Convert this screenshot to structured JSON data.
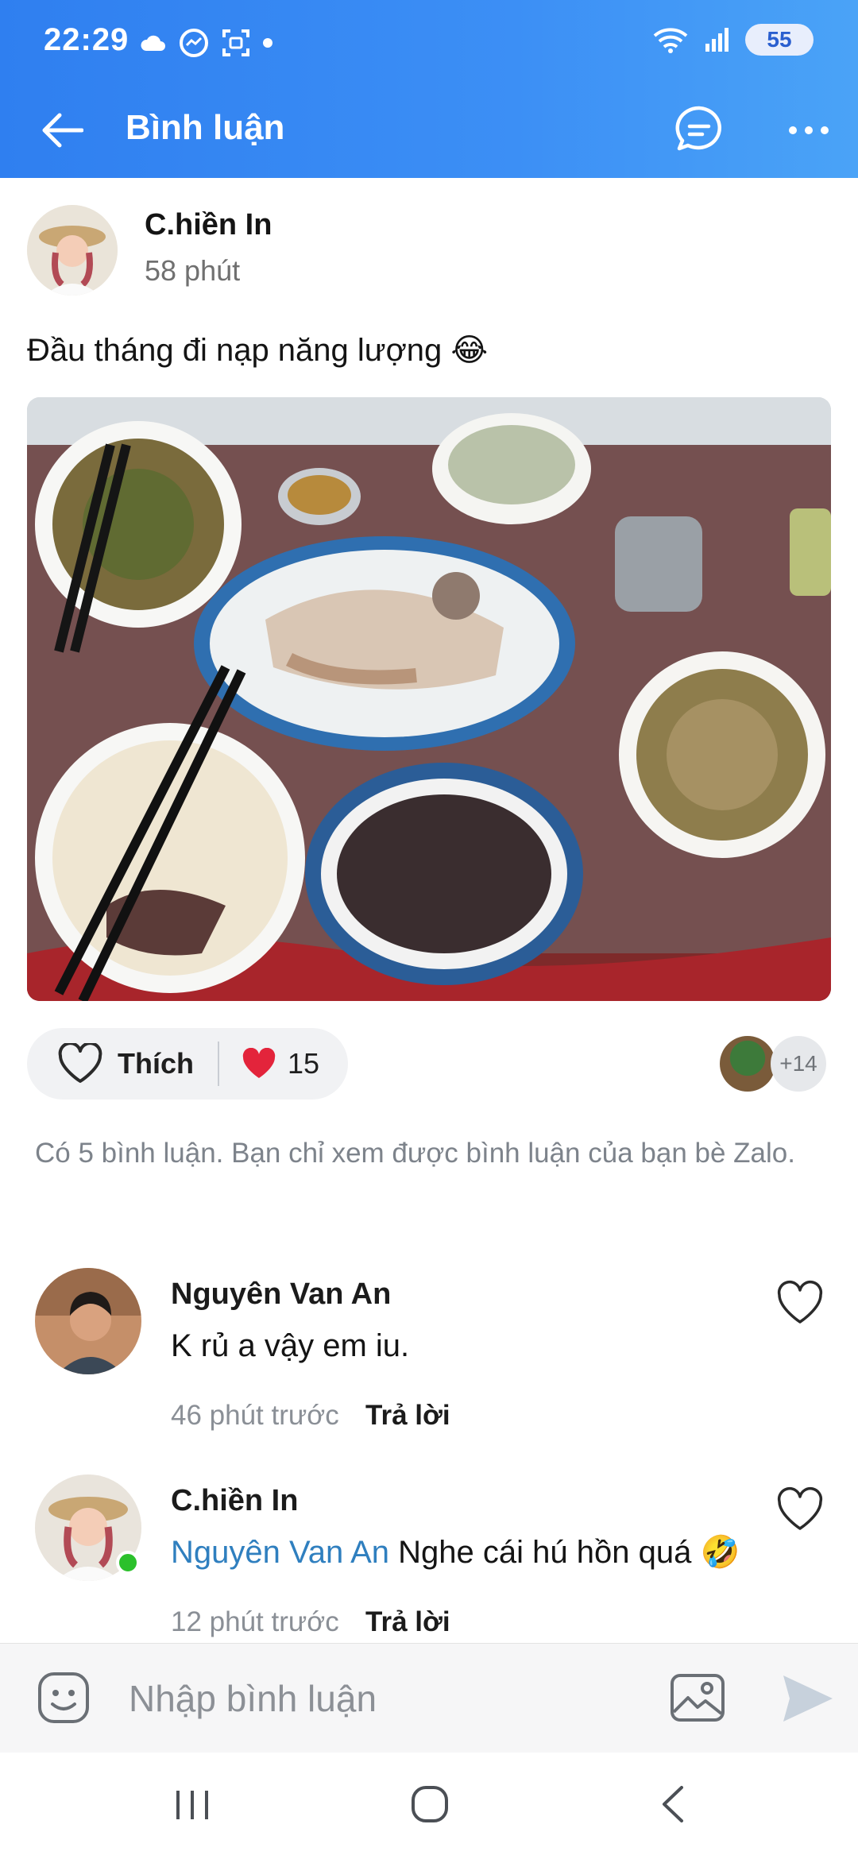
{
  "status_bar": {
    "time": "22:29",
    "battery": "55",
    "icons_left": [
      "cloud-icon",
      "messenger-icon",
      "screenshot-icon",
      "dot-icon"
    ],
    "icons_right": [
      "wifi-icon",
      "signal-icon"
    ]
  },
  "app_bar": {
    "title": "Bình luận",
    "icons": [
      "back-arrow-icon",
      "chat-bubble-icon",
      "more-dots-icon"
    ]
  },
  "post": {
    "author": "C.hiền In",
    "time": "58 phút",
    "text": "Đầu tháng đi nạp năng lượng 😂",
    "image_alt": "food photo"
  },
  "reactions": {
    "like_label": "Thích",
    "heart_count": "15",
    "more_reactors": "+14"
  },
  "info_text": "Có 5 bình luận. Bạn chỉ xem được bình luận của bạn bè Zalo.",
  "comments": [
    {
      "name": "Nguyên Van An",
      "text": "K rủ a vậy em iu.",
      "time": "46 phút trước",
      "reply": "Trả lời"
    },
    {
      "name": "C.hiền In",
      "mention": "Nguyên Van An",
      "text": " Nghe cái hú hồn quá 🤣",
      "time": "12 phút trước",
      "reply": "Trả lời"
    }
  ],
  "input": {
    "placeholder": "Nhập bình luận"
  },
  "colors": {
    "header_blue": "#3c8ff5",
    "mention_blue": "#2f7fbf",
    "heart_red": "#e3243b",
    "online_green": "#2bc02b"
  }
}
